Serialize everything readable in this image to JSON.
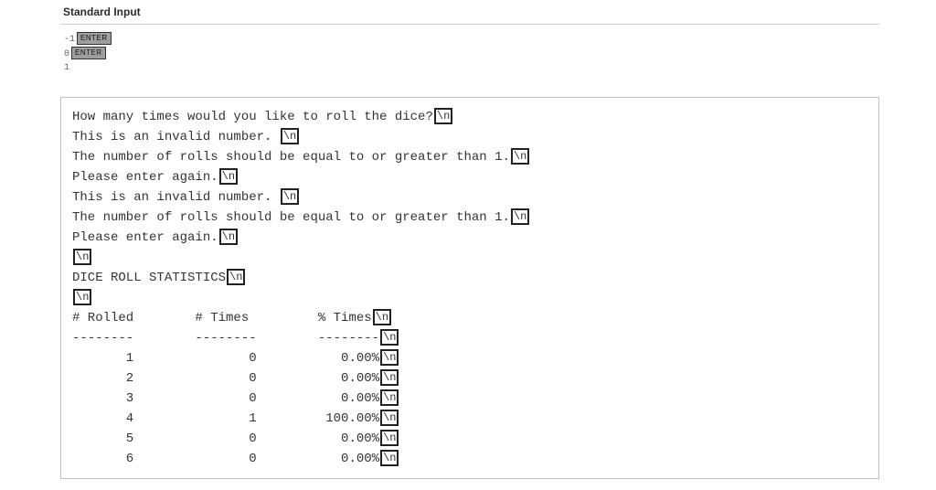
{
  "section": {
    "title": "Standard Input"
  },
  "inputs": {
    "lines": [
      {
        "text": "-1",
        "has_enter": true
      },
      {
        "text": "0",
        "has_enter": true
      },
      {
        "text": "1",
        "has_enter": false
      }
    ],
    "enter_label": "ENTER"
  },
  "newline_token": "\\n",
  "output": {
    "lines": [
      {
        "text": "How many times would you like to roll the dice?",
        "nl": true
      },
      {
        "text": "This is an invalid number. ",
        "nl": true
      },
      {
        "text": "The number of rolls should be equal to or greater than 1.",
        "nl": true
      },
      {
        "text": "Please enter again.",
        "nl": true
      },
      {
        "text": "This is an invalid number. ",
        "nl": true
      },
      {
        "text": "The number of rolls should be equal to or greater than 1.",
        "nl": true
      },
      {
        "text": "Please enter again.",
        "nl": true
      },
      {
        "text": "",
        "nl": true
      },
      {
        "text": "DICE ROLL STATISTICS",
        "nl": true
      },
      {
        "text": "",
        "nl": true
      },
      {
        "text": "# Rolled        # Times         % Times",
        "nl": true
      },
      {
        "text": "--------        --------        --------",
        "nl": true
      },
      {
        "text": "       1               0           0.00%",
        "nl": true
      },
      {
        "text": "       2               0           0.00%",
        "nl": true
      },
      {
        "text": "       3               0           0.00%",
        "nl": true
      },
      {
        "text": "       4               1         100.00%",
        "nl": true
      },
      {
        "text": "       5               0           0.00%",
        "nl": true
      },
      {
        "text": "       6               0           0.00%",
        "nl": true
      }
    ]
  }
}
